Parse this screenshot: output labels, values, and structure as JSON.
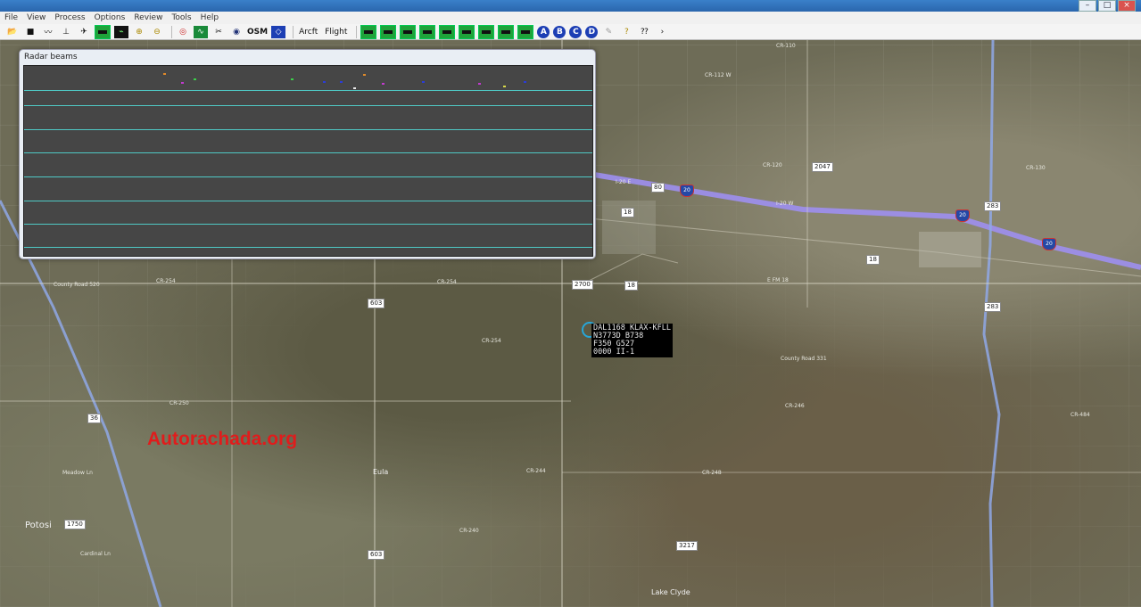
{
  "menu": [
    "File",
    "View",
    "Process",
    "Options",
    "Review",
    "Tools",
    "Help"
  ],
  "toolbar": {
    "osm_label": "OSM",
    "aircraft_label": "Arcft",
    "flight_label": "Flight",
    "circle_labels": [
      "A",
      "B",
      "C",
      "D"
    ]
  },
  "radar_window": {
    "title": "Radar beams"
  },
  "flight_label": {
    "line1": "DAL1168 KLAX-KFLL",
    "line2": "N3773D B738",
    "line3": "F350 G527",
    "line4": "0000 II-1"
  },
  "watermark": "Autorachada.org",
  "map_labels": {
    "cr110": "CR-110",
    "cr112w": "CR-112 W",
    "cr120": "CR-120",
    "cr130": "CR-130",
    "i20e": "I-20 E",
    "i20w": "I-20 W",
    "cr254a": "CR-254",
    "cr254b": "CR-254",
    "cr254c": "CR-254",
    "county520": "County Road 520",
    "countyroad": "County Road 331",
    "cr250": "CR-250",
    "cr240": "CR-240",
    "cr244": "CR-244",
    "cr248": "CR-248",
    "cr246": "CR-246",
    "cr484": "CR-484",
    "fm": "E FM 18",
    "meadow": "Meadow Ln",
    "cardinal": "Cardinal Ln",
    "lake": "Lake Clyde",
    "potosi": "Potosi",
    "eula": "Eula"
  },
  "shields": {
    "s2047": "2047",
    "s80": "80",
    "s18a": "18",
    "s18b": "18",
    "s18c": "18",
    "s283a": "283",
    "s283b": "283",
    "s2700": "2700",
    "s603a": "603",
    "s603b": "603",
    "s36": "36",
    "s1750": "1750",
    "s3217": "3217"
  },
  "interstate_shields": {
    "i20a": "20",
    "i20b": "20",
    "i20c": "20"
  },
  "colors": {
    "beam_line": "#4fc9c5",
    "radar_bg": "#464646",
    "watermark": "#e01c1c",
    "interstate": "#9d8ff0"
  }
}
